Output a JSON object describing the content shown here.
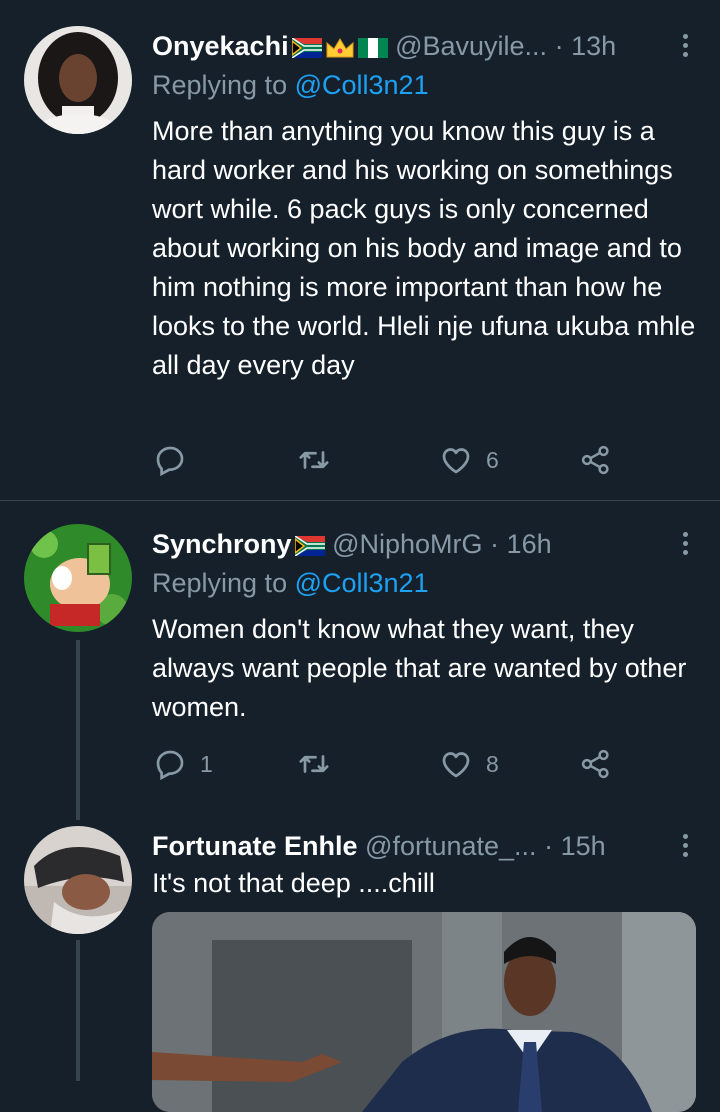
{
  "tweets": [
    {
      "name": "Onyekachi",
      "handle": "@Bavuyile...",
      "time": "13h",
      "reply_prefix": "Replying to ",
      "reply_to": "@Coll3n21",
      "text": "More than anything you know this guy is a hard worker and his working on somethings wort while. 6 pack guys is only concerned about working on his body and image and to him nothing is more important than how he looks to the world. Hleli nje ufuna ukuba mhle all day every day",
      "reply_count": "",
      "like_count": "6"
    },
    {
      "name": "Synchrony",
      "handle": "@NiphoMrG",
      "time": "16h",
      "reply_prefix": "Replying to ",
      "reply_to": "@Coll3n21",
      "text": "Women don't know what they want, they always want people that are wanted by other women.",
      "reply_count": "1",
      "like_count": "8"
    },
    {
      "name": "Fortunate Enhle",
      "handle": "@fortunate_...",
      "time": "15h",
      "text": "It's not that deep ....chill"
    }
  ],
  "separator": "·",
  "icons": [
    "reply-icon",
    "retweet-icon",
    "like-icon",
    "share-icon",
    "more-icon",
    "flag-south-africa-icon",
    "crown-icon",
    "flag-nigeria-icon"
  ],
  "colors": {
    "background": "#15202b",
    "muted": "#8899a6",
    "mention": "#1da1f2",
    "divider": "#38444d"
  }
}
